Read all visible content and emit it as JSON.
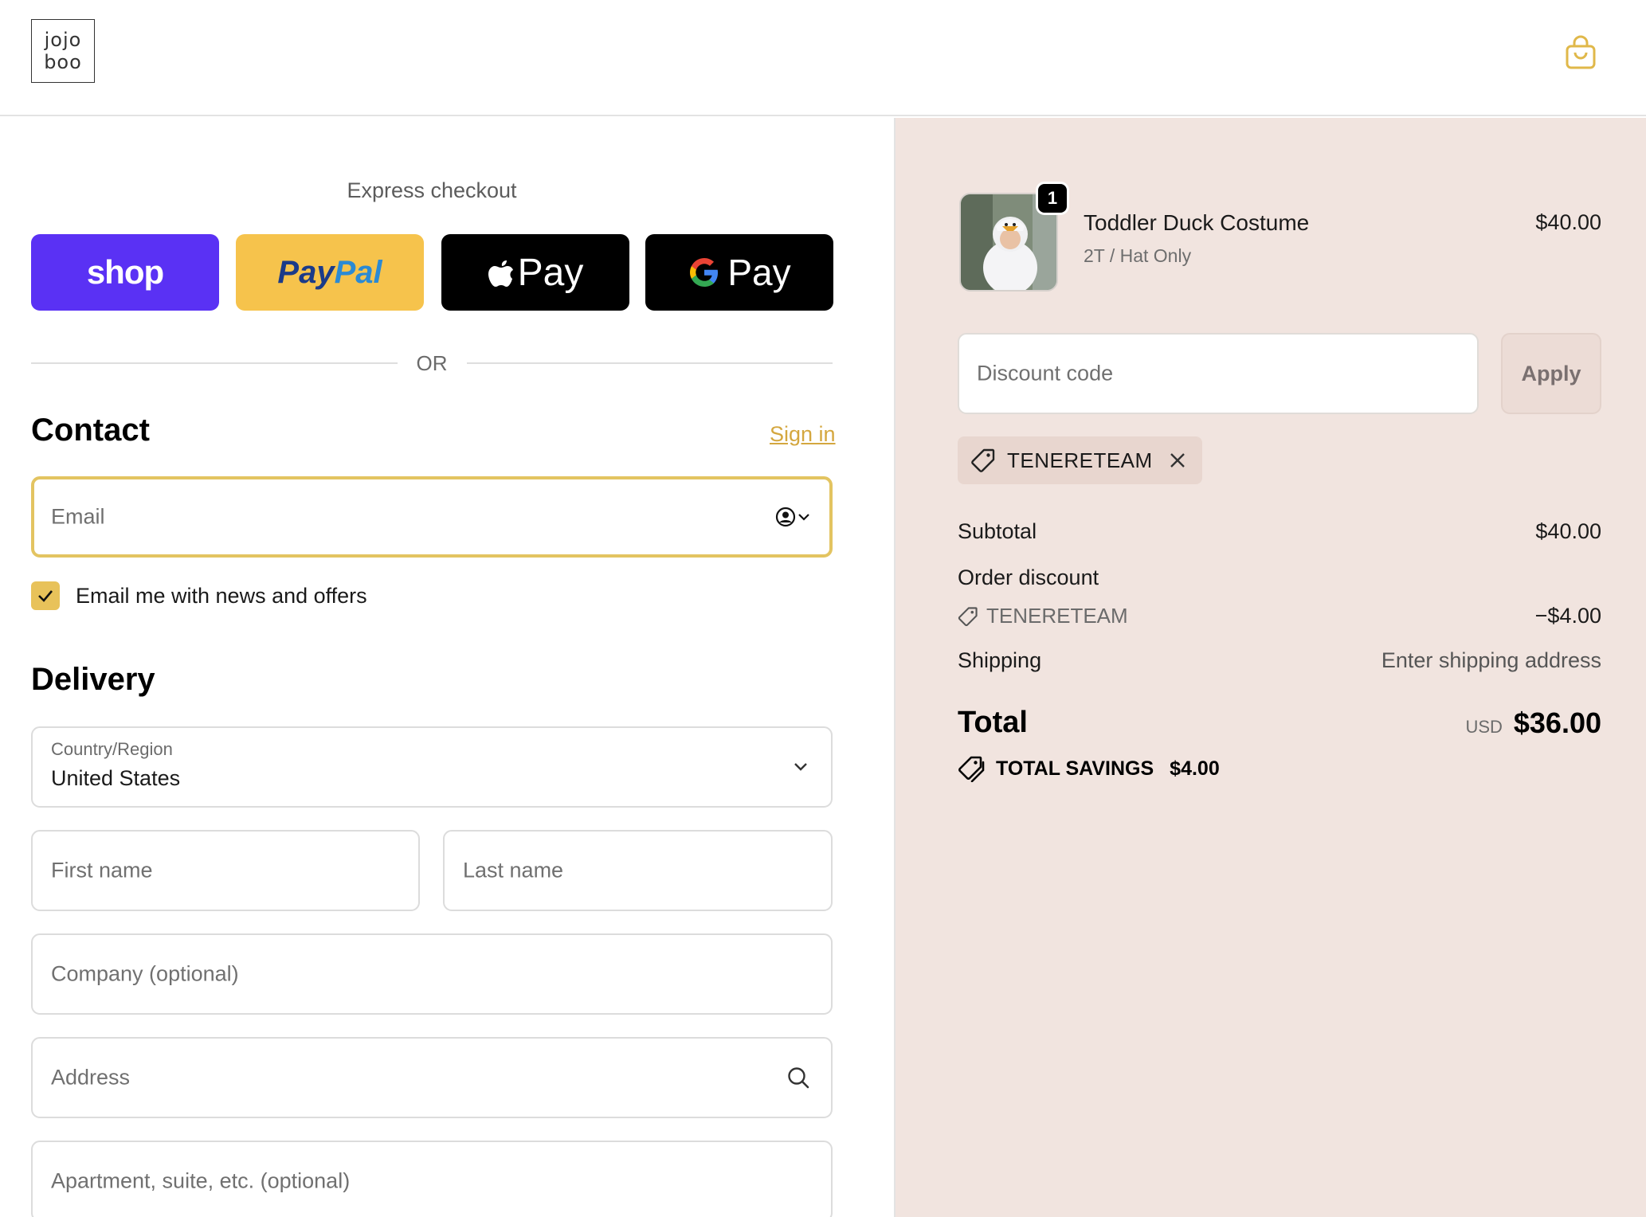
{
  "header": {
    "logo_line1": "jojo",
    "logo_line2": "boo"
  },
  "express": {
    "title": "Express checkout",
    "buttons": [
      {
        "id": "shop",
        "label": "shop"
      },
      {
        "id": "paypal",
        "label_part1": "Pay",
        "label_part2": "Pal"
      },
      {
        "id": "apple",
        "label": "Pay"
      },
      {
        "id": "google",
        "label": "Pay"
      }
    ],
    "or_label": "OR"
  },
  "contact": {
    "title": "Contact",
    "sign_in": "Sign in",
    "email_placeholder": "Email",
    "newsletter_label": "Email me with news and offers",
    "newsletter_checked": true
  },
  "delivery": {
    "title": "Delivery",
    "country_label": "Country/Region",
    "country_value": "United States",
    "first_name_placeholder": "First name",
    "last_name_placeholder": "Last name",
    "company_placeholder": "Company (optional)",
    "address_placeholder": "Address",
    "apartment_placeholder": "Apartment, suite, etc. (optional)"
  },
  "order": {
    "item": {
      "quantity": "1",
      "name": "Toddler Duck Costume",
      "variant": "2T / Hat Only",
      "price": "$40.00"
    },
    "discount_placeholder": "Discount code",
    "apply_label": "Apply",
    "applied_code": "TENERETEAM",
    "subtotal_label": "Subtotal",
    "subtotal_value": "$40.00",
    "order_discount_label": "Order discount",
    "discount_code": "TENERETEAM",
    "discount_value": "−$4.00",
    "shipping_label": "Shipping",
    "shipping_value": "Enter shipping address",
    "total_label": "Total",
    "currency": "USD",
    "total_value": "$36.00",
    "savings_label": "TOTAL SAVINGS",
    "savings_value": "$4.00"
  },
  "colors": {
    "accent": "#e3c461",
    "shop_purple": "#5a31f4",
    "paypal_yellow": "#f6c34c",
    "summary_bg": "#f1e4df"
  }
}
